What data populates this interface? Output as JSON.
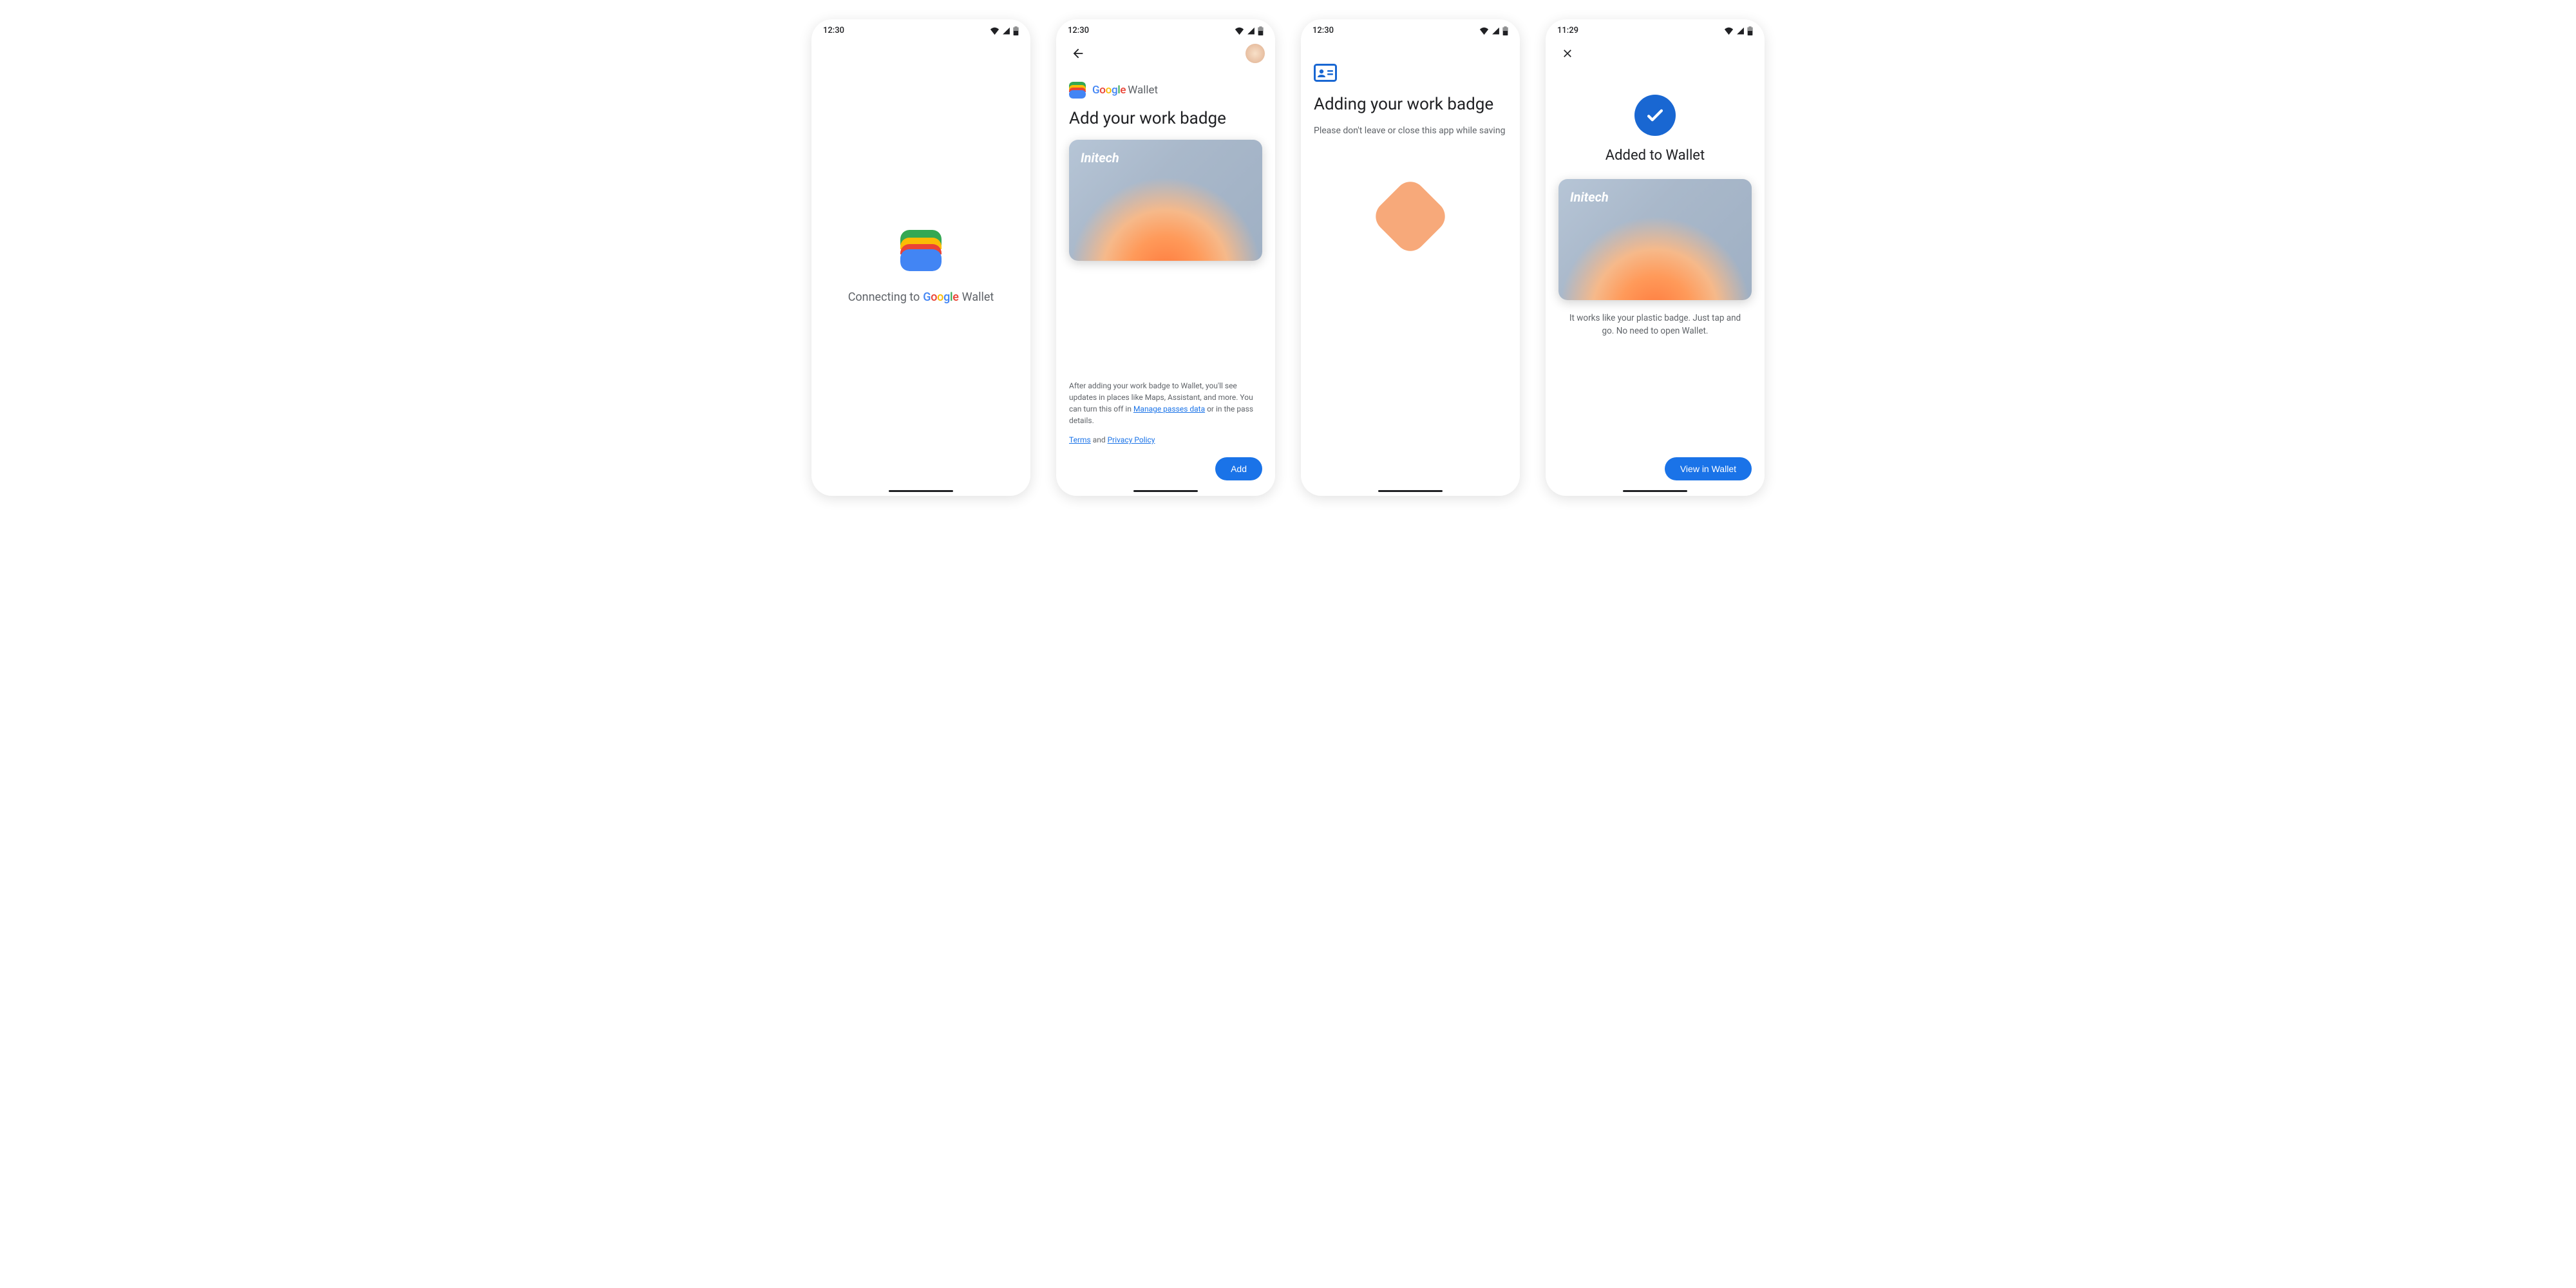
{
  "status": {
    "time_a": "12:30",
    "time_b": "11:29"
  },
  "screen1": {
    "connecting_prefix": "Connecting to",
    "wallet_word": "Wallet"
  },
  "screen2": {
    "wallet_word": "Wallet",
    "headline": "Add your work badge",
    "card_brand": "Initech",
    "disclosure_before": "After adding your work badge to Wallet, you'll see updates in places like Maps, Assistant, and more. You can turn this off in ",
    "manage_link": "Manage passes data",
    "disclosure_after": " or in the pass details.",
    "terms": "Terms",
    "and": " and ",
    "privacy": "Privacy Policy",
    "add_btn": "Add"
  },
  "screen3": {
    "headline": "Adding your work badge",
    "sub": "Please don't leave or close this app while saving"
  },
  "screen4": {
    "headline": "Added to Wallet",
    "card_brand": "Initech",
    "desc": "It works like your plastic badge. Just tap and go. No need to open Wallet.",
    "view_btn": "View in Wallet"
  }
}
